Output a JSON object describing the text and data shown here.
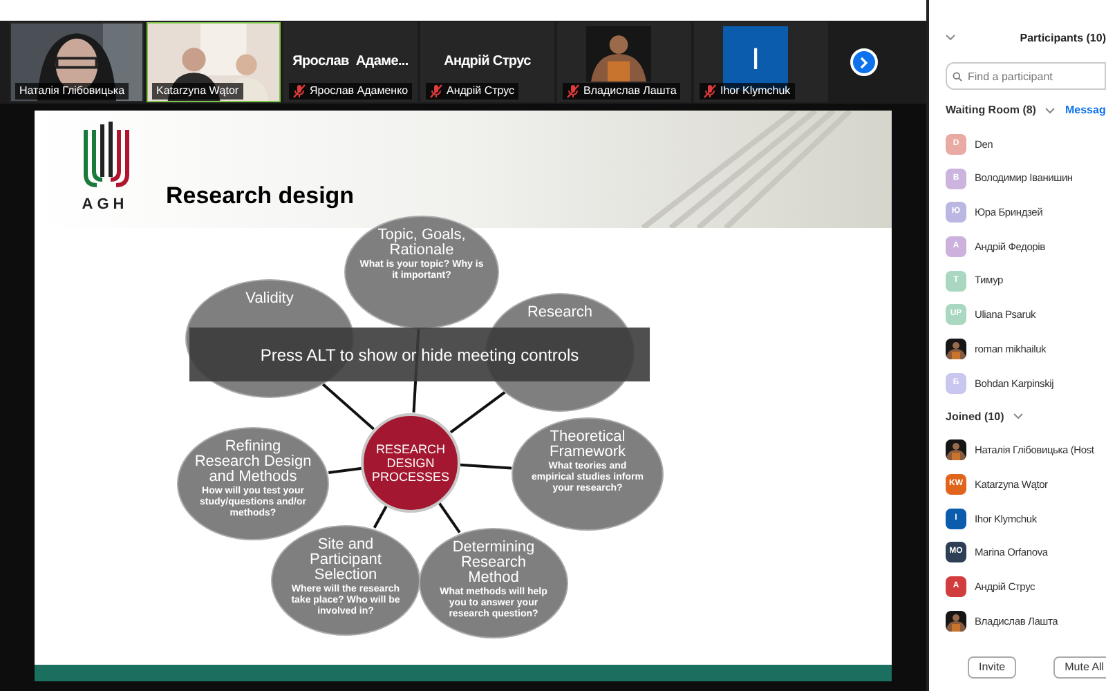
{
  "video_strip": {
    "tiles": [
      {
        "kind": "video",
        "name": "Наталія Глібовицька",
        "muted": false,
        "speaking": false
      },
      {
        "kind": "video",
        "name": "Katarzyna Wątor",
        "muted": false,
        "speaking": true
      },
      {
        "kind": "name",
        "display": "Ярослав  Адаме...",
        "name": "Ярослав Адаменко",
        "muted": true,
        "speaking": false
      },
      {
        "kind": "name",
        "display": "Андрій Струс",
        "name": "Андрій Струс",
        "muted": true,
        "speaking": false
      },
      {
        "name": "Владислав Лашта",
        "muted": true,
        "speaking": false
      },
      {
        "kind": "initial",
        "initial": "I",
        "color": "#0b5cad",
        "name": "Ihor Klymchuk",
        "muted": true,
        "speaking": false
      }
    ]
  },
  "slide": {
    "logo_text": "AGH",
    "title": "Research design",
    "center": "RESEARCH DESIGN PROCESSES",
    "nodes": [
      {
        "title": "Topic, Goals, Rationale",
        "body": "What is your topic? Why is it important?"
      },
      {
        "title": "Validity"
      },
      {
        "title": "Research"
      },
      {
        "title": "Theoretical Framework",
        "body": "What teories and empirical studies inform your research?"
      },
      {
        "title": "Site and Participant Selection",
        "body": "Where will the research take place? Who will be involved in?"
      },
      {
        "title": "Determining Research Method",
        "body": "What methods will help you to answer your research question?"
      },
      {
        "title": "Refining Research Design and Methods",
        "body": "How will you test your study/questions and/or methods?"
      }
    ]
  },
  "overlay": "Press ALT to show or hide meeting controls",
  "participants": {
    "title": "Participants (10)",
    "search": {
      "placeholder": "Find a participant"
    },
    "waiting_room": {
      "label": "Waiting Room (8)",
      "expanded": true,
      "action": "Messag",
      "people": [
        {
          "name": "Den",
          "avatar": {
            "kind": "initials",
            "initials": "D",
            "color": "#e8aaa3"
          }
        },
        {
          "name": "Володимир Іванишин",
          "avatar": {
            "kind": "initials",
            "initials": "В",
            "color": "#cbb4de"
          }
        },
        {
          "name": "Юра Бриндзей",
          "avatar": {
            "kind": "initials",
            "initials": "Ю",
            "color": "#bab8e2"
          }
        },
        {
          "name": "Андрій Федорів",
          "avatar": {
            "kind": "initials",
            "initials": "A",
            "color": "#cdb1dd"
          }
        },
        {
          "name": "Тимур",
          "avatar": {
            "kind": "initials",
            "initials": "T",
            "color": "#a9d7bf"
          }
        },
        {
          "name": "Uliana Psaruk",
          "avatar": {
            "kind": "initials",
            "initials": "UP",
            "color": "#a9d7bf"
          }
        },
        {
          "name": "roman mikhailuk"
        },
        {
          "name": "Bohdan Karpinskij",
          "avatar": {
            "kind": "initials",
            "initials": "Б",
            "color": "#c9c7ef"
          }
        }
      ]
    },
    "joined": {
      "label": "Joined (10)",
      "expanded": true,
      "people": [
        {
          "name": "Наталія Глібовицька (Host"
        },
        {
          "name": "Katarzyna Wątor",
          "avatar": {
            "kind": "initials",
            "initials": "KW",
            "color": "#e0641b"
          }
        },
        {
          "name": "Ihor Klymchuk",
          "avatar": {
            "kind": "initials",
            "initials": "I",
            "color": "#0b5cad"
          }
        },
        {
          "name": "Marina Orfanova",
          "avatar": {
            "kind": "initials",
            "initials": "MO",
            "color": "#2d3e55"
          }
        },
        {
          "name": "Андрій Струс",
          "avatar": {
            "kind": "initials",
            "initials": "A",
            "color": "#d13c3c"
          }
        },
        {
          "name": "Владислав Лашта"
        }
      ]
    },
    "buttons": [
      "Invite",
      "Mute All"
    ]
  }
}
